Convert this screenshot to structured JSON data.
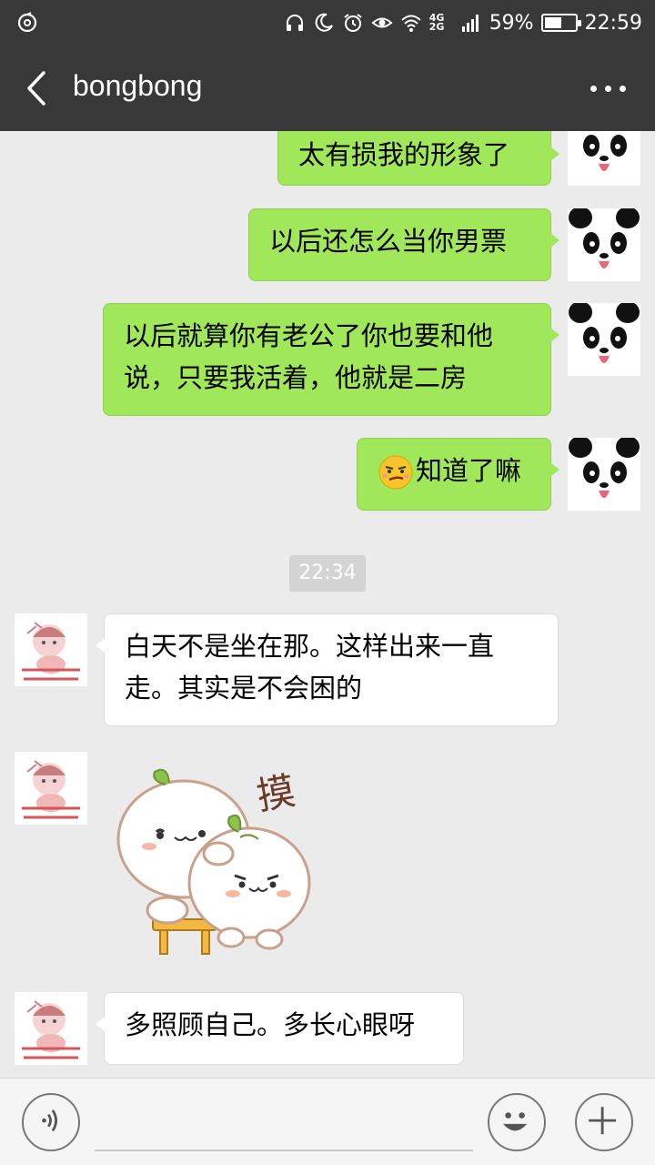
{
  "status_bar": {
    "network": "4G 2G",
    "battery": "59%",
    "battery_level": 0.59,
    "time": "22:59",
    "icons": [
      "netease-music-icon",
      "headphones-icon",
      "moon-icon",
      "alarm-icon",
      "eye-icon",
      "wifi-icon",
      "signal-icon",
      "battery-icon"
    ]
  },
  "header": {
    "title": "bongbong",
    "back_icon": "chevron-left-icon",
    "more_icon": "more-dots-icon"
  },
  "messages": [
    {
      "sender": "me",
      "text": "太有损我的形象了"
    },
    {
      "sender": "me",
      "text": "以后还怎么当你男票"
    },
    {
      "sender": "me",
      "text": "以后就算你有老公了你也要和他说，只要我活着，他就是二房"
    },
    {
      "sender": "me",
      "text": "知道了嘛",
      "emoji": "smirk-emoji"
    },
    {
      "sender": "other",
      "text": "白天不是坐在那。这样出来一直走。其实是不会困的"
    },
    {
      "sender": "other",
      "sticker": "two-bun-stickers",
      "sticker_text": "摸"
    },
    {
      "sender": "other",
      "text": "多照顾自己。多长心眼呀"
    }
  ],
  "timestamp": "22:34",
  "input_bar": {
    "voice_icon": "voice-icon",
    "input_value": "",
    "emoji_icon": "smiley-icon",
    "plus_icon": "plus-icon"
  },
  "colors": {
    "header_bg": "#383838",
    "my_bubble": "#a0e75a",
    "other_bubble": "#ffffff",
    "chat_bg": "#ebebeb"
  }
}
